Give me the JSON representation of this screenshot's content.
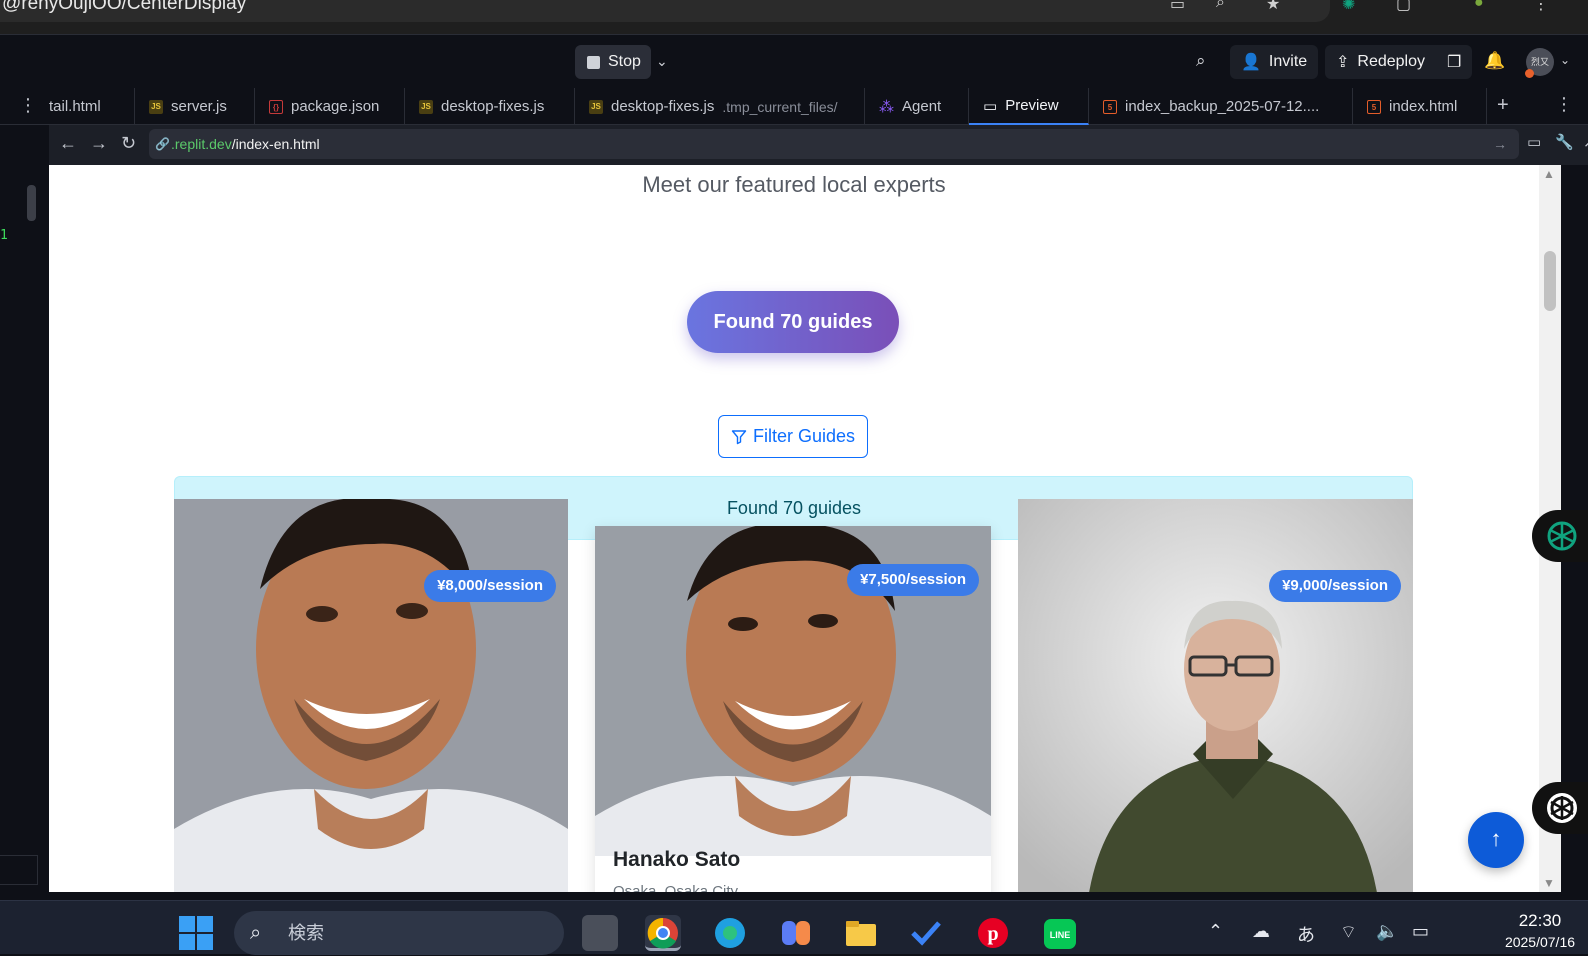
{
  "browser": {
    "title_fragment": "@renyOujiOO/CenterDisplay"
  },
  "topbar": {
    "stop_label": "Stop",
    "invite_label": "Invite",
    "redeploy_label": "Redeploy",
    "avatar_text": "烈又"
  },
  "tabs": [
    {
      "label": "tail.html",
      "kind": "html"
    },
    {
      "label": "server.js",
      "kind": "js"
    },
    {
      "label": "package.json",
      "kind": "json"
    },
    {
      "label": "desktop-fixes.js",
      "kind": "js"
    },
    {
      "label": "desktop-fixes.js",
      "sub": ".tmp_current_files/",
      "kind": "js"
    },
    {
      "label": "Agent",
      "kind": "agent"
    },
    {
      "label": "Preview",
      "kind": "preview",
      "active": true
    },
    {
      "label": "index_backup_2025-07-12....",
      "kind": "html"
    },
    {
      "label": "index.html",
      "kind": "html"
    }
  ],
  "address": {
    "domain": ".replit.dev",
    "path": "/index-en.html"
  },
  "gutter": {
    "line_number": "1"
  },
  "page": {
    "subtitle": "Meet our featured local experts",
    "found_pill": "Found 70 guides",
    "filter_label": "Filter Guides",
    "alert_text": "Found 70 guides",
    "cards": [
      {
        "price": "¥8,000/session"
      },
      {
        "price": "¥7,500/session",
        "name": "Hanako Sato",
        "location": "Osaka, Osaka City"
      },
      {
        "price": "¥9,000/session"
      }
    ]
  },
  "taskbar": {
    "search_placeholder": "検索",
    "time": "22:30",
    "date": "2025/07/16",
    "ime": "あ"
  },
  "colors": {
    "accent": "#0d6efd",
    "price_badge": "#3b7be8",
    "pill_gradient_start": "#6a75e0",
    "pill_gradient_end": "#7a4fb8",
    "alert_bg": "#cff4fc"
  }
}
